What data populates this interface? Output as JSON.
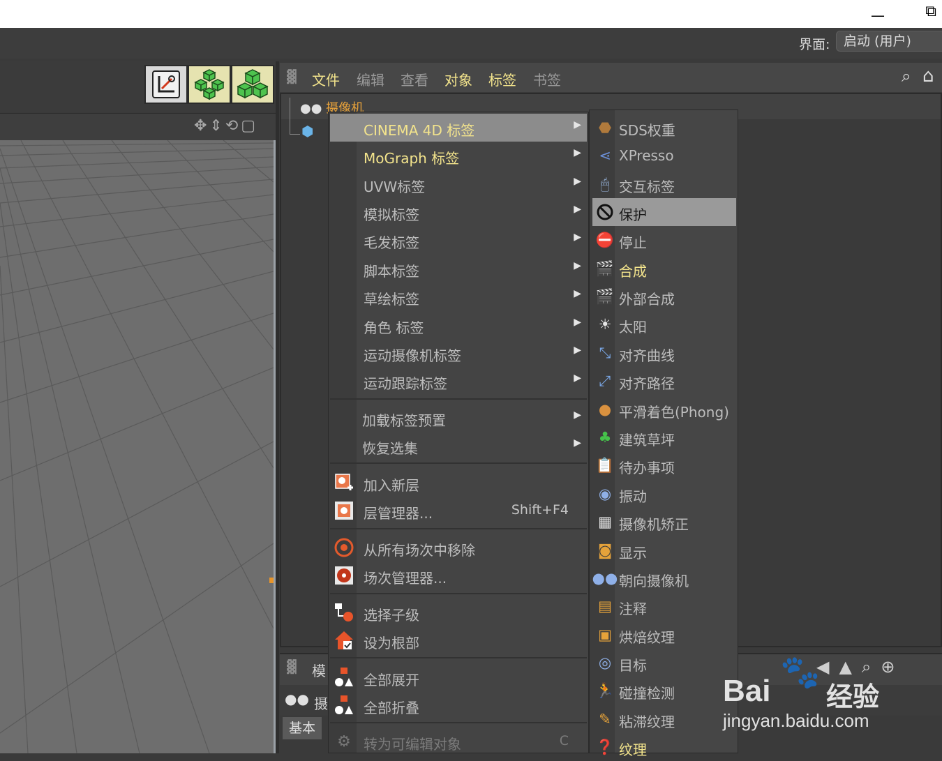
{
  "window": {
    "minimize_glyph": "—",
    "restore_glyph": "⧉"
  },
  "layout": {
    "label": "界面:",
    "value": "启动 (用户)"
  },
  "object_manager": {
    "menus": [
      "文件",
      "编辑",
      "查看",
      "对象",
      "标签",
      "书签"
    ],
    "rows": [
      {
        "label": "摄像机",
        "icon": "camera-icon"
      },
      {
        "label": "",
        "icon": "cube-icon"
      }
    ]
  },
  "attribute_manager": {
    "title": "模",
    "camera_label": "摄",
    "tab": "基本"
  },
  "context_menu": {
    "items": [
      {
        "label": "CINEMA 4D 标签",
        "submenu": true,
        "state": "highlighted"
      },
      {
        "label": "MoGraph 标签",
        "submenu": true,
        "state": "yellow"
      },
      {
        "label": "UVW标签",
        "submenu": true
      },
      {
        "label": "模拟标签",
        "submenu": true
      },
      {
        "label": "毛发标签",
        "submenu": true
      },
      {
        "label": "脚本标签",
        "submenu": true
      },
      {
        "label": "草绘标签",
        "submenu": true
      },
      {
        "label": "角色 标签",
        "submenu": true
      },
      {
        "label": "运动摄像机标签",
        "submenu": true
      },
      {
        "label": "运动跟踪标签",
        "submenu": true
      },
      {
        "label": "加载标签预置",
        "submenu": true
      },
      {
        "label": "恢复选集",
        "submenu": true
      },
      {
        "label": "加入新层",
        "icon": "add-layer-icon"
      },
      {
        "label": "层管理器...",
        "shortcut": "Shift+F4",
        "icon": "layer-manager-icon"
      },
      {
        "label": "从所有场次中移除",
        "icon": "remove-take-icon"
      },
      {
        "label": "场次管理器...",
        "icon": "take-manager-icon"
      },
      {
        "label": "选择子级",
        "icon": "select-children-icon"
      },
      {
        "label": "设为根部",
        "icon": "set-root-icon"
      },
      {
        "label": "全部展开",
        "icon": "expand-all-icon"
      },
      {
        "label": "全部折叠",
        "icon": "collapse-all-icon"
      },
      {
        "label": "转为可编辑对象",
        "shortcut": "C",
        "state": "disabled",
        "icon": "make-editable-icon"
      }
    ]
  },
  "submenu": {
    "items": [
      {
        "label": "SDS权重",
        "icon": "sds-weight-icon"
      },
      {
        "label": "XPresso",
        "icon": "xpresso-icon"
      },
      {
        "label": "交互标签",
        "icon": "interaction-tag-icon"
      },
      {
        "label": "保护",
        "icon": "protection-icon",
        "state": "highlighted"
      },
      {
        "label": "停止",
        "icon": "stop-icon"
      },
      {
        "label": "合成",
        "icon": "compositing-icon",
        "state": "yellow"
      },
      {
        "label": "外部合成",
        "icon": "external-compositing-icon"
      },
      {
        "label": "太阳",
        "icon": "sun-icon"
      },
      {
        "label": "对齐曲线",
        "icon": "align-to-spline-icon"
      },
      {
        "label": "对齐路径",
        "icon": "align-to-path-icon"
      },
      {
        "label": "平滑着色(Phong)",
        "icon": "phong-icon"
      },
      {
        "label": "建筑草坪",
        "icon": "grass-icon"
      },
      {
        "label": "待办事项",
        "icon": "todo-icon"
      },
      {
        "label": "振动",
        "icon": "vibrate-icon"
      },
      {
        "label": "摄像机矫正",
        "icon": "camera-calibrator-icon"
      },
      {
        "label": "显示",
        "icon": "display-icon"
      },
      {
        "label": "朝向摄像机",
        "icon": "look-at-camera-icon"
      },
      {
        "label": "注释",
        "icon": "annotation-icon"
      },
      {
        "label": "烘焙纹理",
        "icon": "bake-texture-icon"
      },
      {
        "label": "目标",
        "icon": "target-icon"
      },
      {
        "label": "碰撞检测",
        "icon": "collision-icon"
      },
      {
        "label": "粘滞纹理",
        "icon": "sticky-texture-icon"
      },
      {
        "label": "纹理",
        "icon": "texture-icon",
        "state": "yellow"
      }
    ]
  },
  "watermark": {
    "brand": "Bai",
    "brand_cn": "经验",
    "url": "jingyan.baidu.com"
  },
  "colors": {
    "highlight": "#8c8c8c",
    "yellow_text": "#f3e48c",
    "menu_bg": "#444444"
  }
}
